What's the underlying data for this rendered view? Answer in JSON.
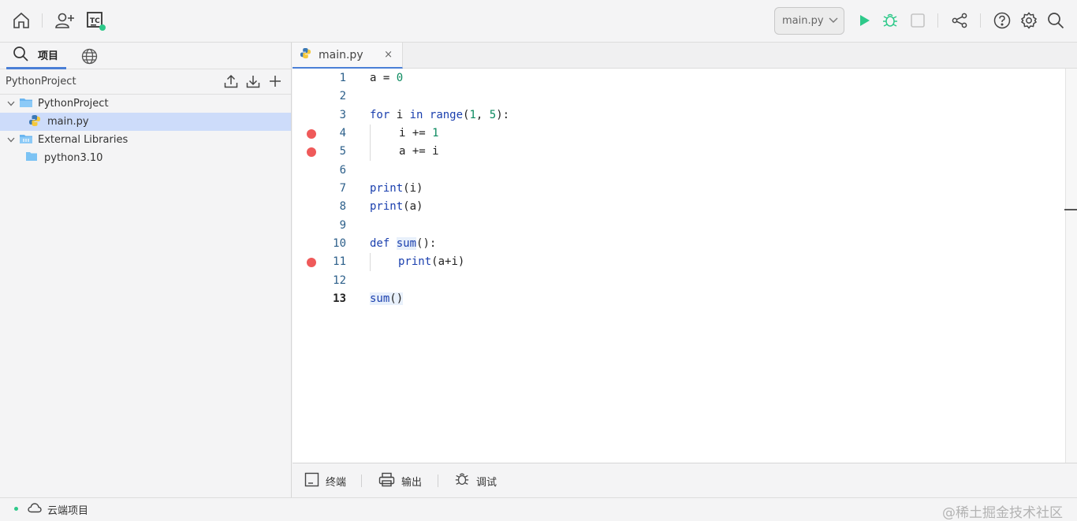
{
  "toolbar": {
    "run_config": "main.py",
    "icons": [
      "home-icon",
      "add-user-icon",
      "ide-logo-icon",
      "run-icon",
      "debug-icon",
      "stop-icon",
      "share-icon",
      "help-icon",
      "settings-icon",
      "search-icon"
    ],
    "status_dot_color": "#2ec98a"
  },
  "sidebar": {
    "tab_project": "项目",
    "project_name": "PythonProject",
    "tree": [
      {
        "label": "PythonProject",
        "type": "folder",
        "expanded": true
      },
      {
        "label": "main.py",
        "type": "python-file",
        "selected": true
      },
      {
        "label": "External Libraries",
        "type": "library",
        "expanded": true
      },
      {
        "label": "python3.10",
        "type": "folder"
      }
    ]
  },
  "editor": {
    "tab_name": "main.py",
    "close_label": "×",
    "lines": [
      {
        "n": "1",
        "breakpoint": false
      },
      {
        "n": "2",
        "breakpoint": false
      },
      {
        "n": "3",
        "breakpoint": false
      },
      {
        "n": "4",
        "breakpoint": true
      },
      {
        "n": "5",
        "breakpoint": true
      },
      {
        "n": "6",
        "breakpoint": false
      },
      {
        "n": "7",
        "breakpoint": false
      },
      {
        "n": "8",
        "breakpoint": false
      },
      {
        "n": "9",
        "breakpoint": false
      },
      {
        "n": "10",
        "breakpoint": false
      },
      {
        "n": "11",
        "breakpoint": true
      },
      {
        "n": "12",
        "breakpoint": false
      },
      {
        "n": "13",
        "breakpoint": false
      }
    ],
    "code": {
      "l1_a": "a = ",
      "l1_num": "0",
      "l3_for": "for",
      "l3_i": " i ",
      "l3_in": "in",
      "l3_sp": " ",
      "l3_range": "range",
      "l3_p1": "(",
      "l3_n1": "1",
      "l3_comma": ", ",
      "l3_n2": "5",
      "l3_p2": "):",
      "l4_code": "i += ",
      "l4_num": "1",
      "l5_code": "a += i",
      "l7_print": "print",
      "l7_args": "(i)",
      "l8_print": "print",
      "l8_args": "(a)",
      "l10_def": "def",
      "l10_sp": " ",
      "l10_sum": "sum",
      "l10_rest": "():",
      "l11_print": "print",
      "l11_args": "(a+i)",
      "l13_sum": "sum",
      "l13_args": "()"
    },
    "breakpoint_color": "#ef5a5a"
  },
  "bottom_tools": {
    "terminal": "终端",
    "output": "输出",
    "debug": "调试"
  },
  "statusbar": {
    "cloud_project": "云端项目",
    "watermark": "@稀土掘金技术社区"
  }
}
